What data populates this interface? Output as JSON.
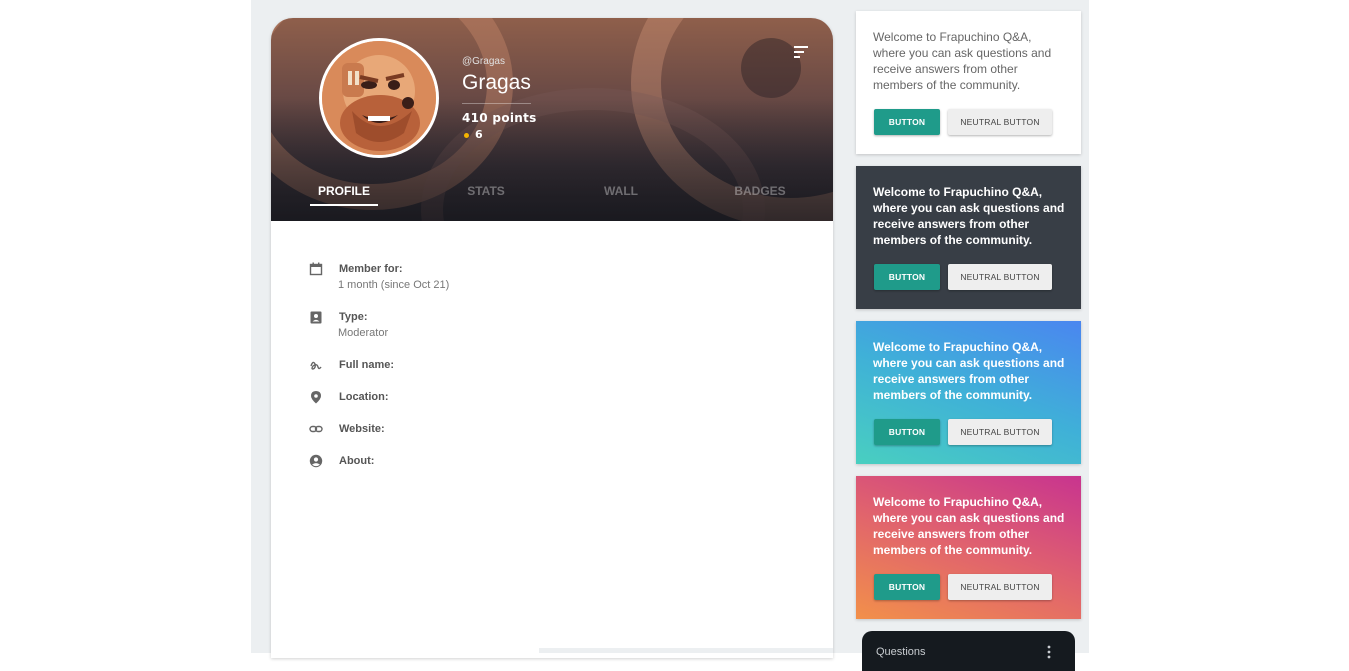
{
  "profile": {
    "handle": "@Gragas",
    "name": "Gragas",
    "points": "410 points",
    "badge_count": "6",
    "tabs": [
      {
        "label": "PROFILE",
        "active": true
      },
      {
        "label": "STATS",
        "active": false
      },
      {
        "label": "WALL",
        "active": false
      },
      {
        "label": "BADGES",
        "active": false
      }
    ],
    "fields": [
      {
        "icon": "calendar-icon",
        "label": "Member for:",
        "value": "1 month (since Oct 21)"
      },
      {
        "icon": "id-badge-icon",
        "label": "Type:",
        "value": "Moderator"
      },
      {
        "icon": "signature-icon",
        "label": "Full name:",
        "value": ""
      },
      {
        "icon": "location-pin-icon",
        "label": "Location:",
        "value": ""
      },
      {
        "icon": "link-icon",
        "label": "Website:",
        "value": ""
      },
      {
        "icon": "account-circle-icon",
        "label": "About:",
        "value": ""
      }
    ]
  },
  "side_cards": [
    {
      "text": "Welcome to Frapuchino Q&A, where you can ask questions and receive answers from other members of the community.",
      "primary_button": "BUTTON",
      "neutral_button": "NEUTRAL BUTTON",
      "theme": "white"
    },
    {
      "text": "Welcome to Frapuchino Q&A, where you can ask questions and receive answers from other members of the community.",
      "primary_button": "BUTTON",
      "neutral_button": "NEUTRAL BUTTON",
      "theme": "dark"
    },
    {
      "text": "Welcome to Frapuchino Q&A, where you can ask questions and receive answers from other members of the community.",
      "primary_button": "BUTTON",
      "neutral_button": "NEUTRAL BUTTON",
      "theme": "blue-gradient"
    },
    {
      "text": "Welcome to Frapuchino Q&A, where you can ask questions and receive answers from other members of the community.",
      "primary_button": "BUTTON",
      "neutral_button": "NEUTRAL BUTTON",
      "theme": "pink-gradient"
    }
  ],
  "questions_widget": {
    "title": "Questions"
  },
  "colors": {
    "primary_button": "#1f9b8a",
    "dark_card": "#383e46",
    "page_bg": "#eceff1",
    "badge_dot": "#f5b400"
  }
}
